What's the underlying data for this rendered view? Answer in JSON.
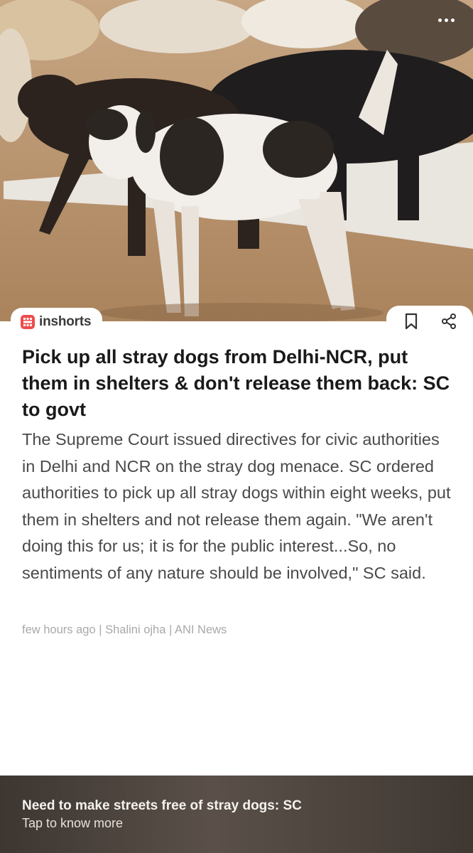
{
  "brand": {
    "name": "inshorts"
  },
  "article": {
    "headline": "Pick up all stray dogs from Delhi-NCR, put them in shelters & don't release them back: SC to govt",
    "body": "The Supreme Court issued directives for civic authorities in Delhi and NCR on the stray dog menace. SC ordered authorities to pick up all stray dogs within eight weeks, put them in shelters and not release them again. \"We aren't doing this for us; it is for the public interest...So, no sentiments of any nature should be involved,\" SC said.",
    "meta": "few hours ago | Shalini ojha | ANI News"
  },
  "footer": {
    "title": "Need to make streets free of stray dogs: SC",
    "subtitle": "Tap to know more"
  },
  "icons": {
    "more": "more-vertical-icon",
    "bookmark": "bookmark-icon",
    "share": "share-icon",
    "brand_logo": "inshorts-logo-icon"
  },
  "colors": {
    "brand_red": "#ef4b4b",
    "headline": "#1a1a1a",
    "body": "#4a4a4a",
    "meta": "#a9a9a9"
  }
}
